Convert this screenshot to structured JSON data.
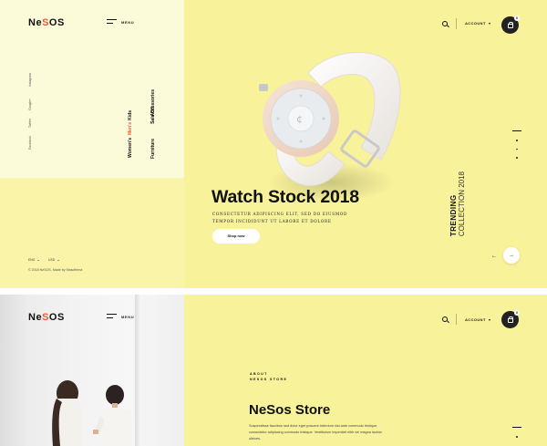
{
  "colors": {
    "background": "#f8f29b",
    "panel": "#fcfbd9",
    "accent": "#e85a3a",
    "dark": "#222222"
  },
  "brand": {
    "logo_main": "Ne",
    "logo_dot": "S",
    "logo_rest": "OS"
  },
  "header": {
    "menu_label": "MENU",
    "account_label": "ACCOUNT",
    "cart_count": "0",
    "icons": {
      "search": "search-icon",
      "cart": "shopping-bag-icon",
      "menu": "hamburger-icon"
    }
  },
  "social": [
    "Facebook",
    "Twitter",
    "Google+",
    "Instagram"
  ],
  "nav": {
    "col1": [
      "Women's",
      "Men's",
      "Kids"
    ],
    "col2": [
      "Furniture",
      "Accessories",
      "Sale Off"
    ],
    "active": "Men's"
  },
  "hero": {
    "title": "Watch Stock 2018",
    "description": "CONSECTETUR ADIPISCING ELIT, SED DO EIUSMOD TEMPOR INCIDIDUNT UT LABORE ET DOLORE",
    "button": "Shop now",
    "trending_line1": "TRENDING",
    "trending_line2": "COLLECTION 2018"
  },
  "footer": {
    "lang": "ENG",
    "currency": "USD",
    "copyright": "© 2018 NeSOS. Made by Masoftema"
  },
  "store": {
    "about_line1": "ABOUT",
    "about_line2": "NESOS STORE",
    "title": "NeSos Store",
    "text": "Suspendisse faucibus sed dolor eget posuere.Interdum nisi ante commodo tristique, consectetur adipiscing commodo tristique. Vestibulum imperdiet nibh vel magna lacinia ultrices."
  }
}
